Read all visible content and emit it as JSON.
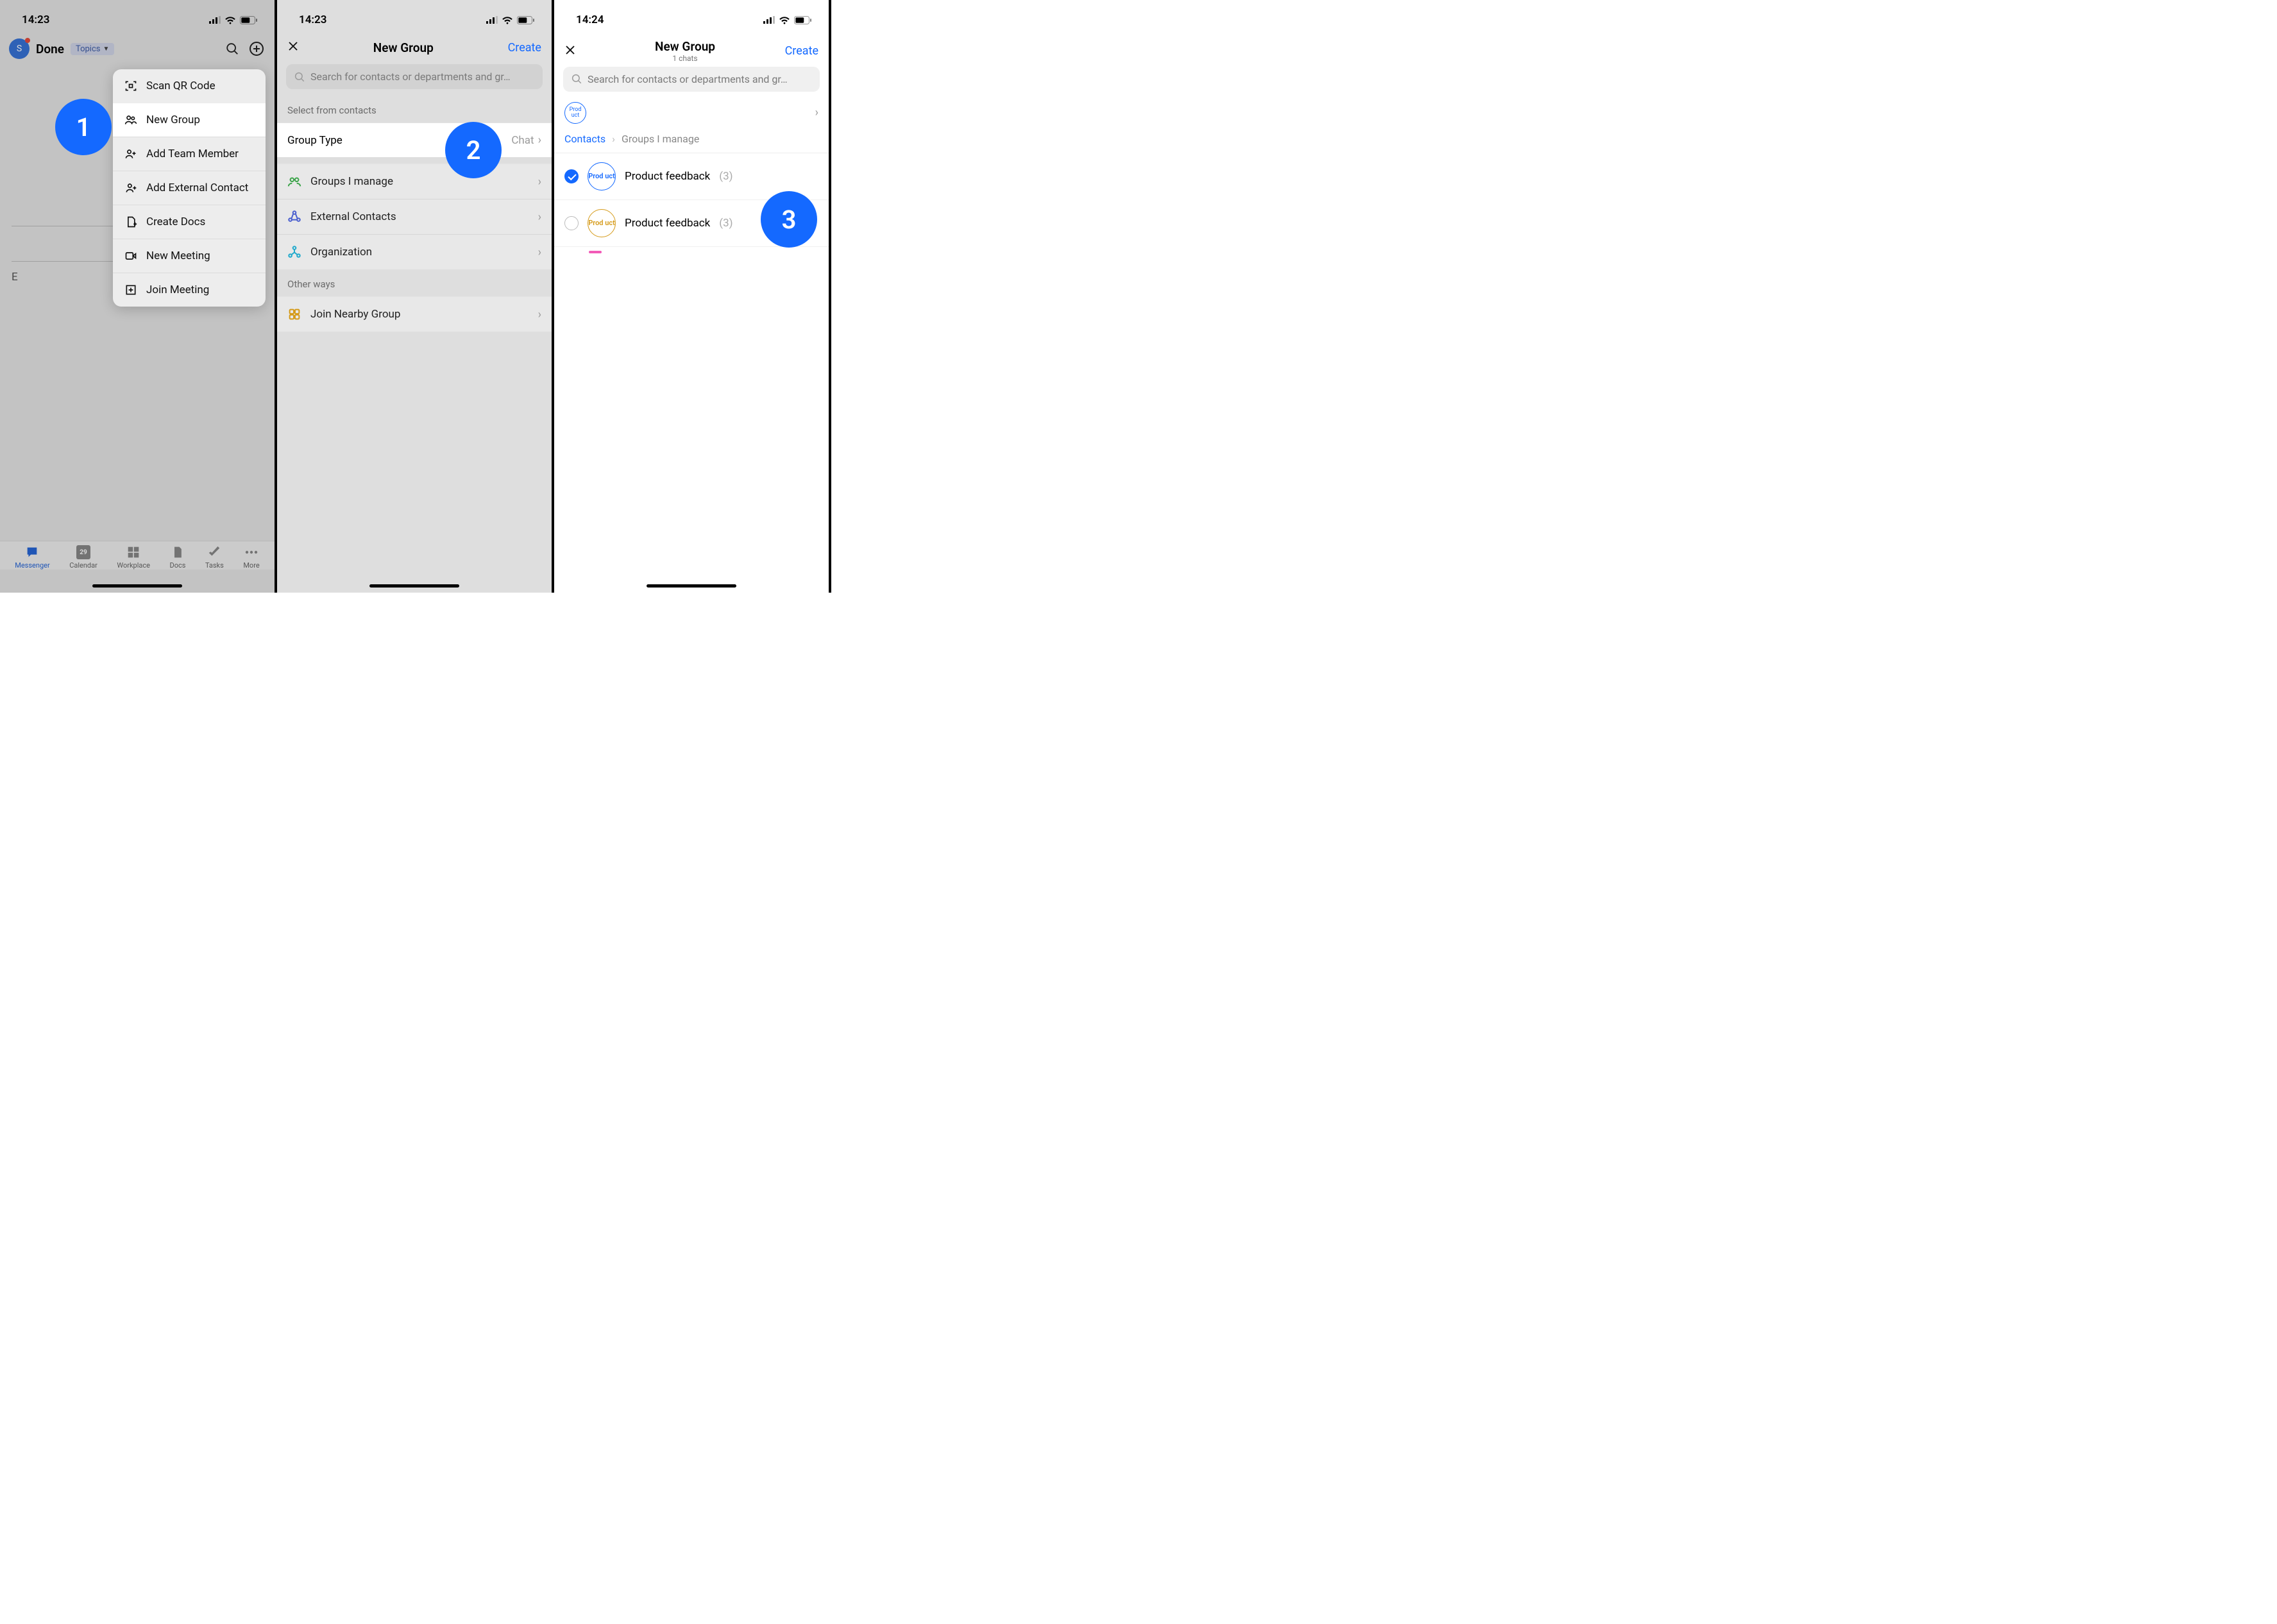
{
  "status": {
    "time1": "14:23",
    "time2": "14:23",
    "time3": "14:24"
  },
  "panel1": {
    "avatar_letter": "S",
    "done_label": "Done",
    "topics_label": "Topics",
    "body_prefix": "E",
    "popup": {
      "scan_qr": "Scan QR Code",
      "new_group": "New Group",
      "add_team_member": "Add Team Member",
      "add_external_contact": "Add External Contact",
      "create_docs": "Create Docs",
      "new_meeting": "New Meeting",
      "join_meeting": "Join Meeting"
    },
    "tabs": {
      "messenger": "Messenger",
      "calendar": "Calendar",
      "calendar_badge": "29",
      "workplace": "Workplace",
      "docs": "Docs",
      "tasks": "Tasks",
      "more": "More"
    }
  },
  "panel2": {
    "title": "New Group",
    "create": "Create",
    "search_placeholder": "Search for contacts or departments and gr…",
    "section_select": "Select from contacts",
    "group_type_label": "Group Type",
    "group_type_value": "Chat",
    "rows": {
      "groups_manage": "Groups I manage",
      "external": "External Contacts",
      "organization": "Organization"
    },
    "section_other": "Other ways",
    "join_nearby": "Join Nearby Group"
  },
  "panel3": {
    "title": "New Group",
    "subtitle": "1 chats",
    "create": "Create",
    "search_placeholder": "Search for contacts or departments and gr…",
    "chip_label": "Prod uct",
    "breadcrumb": {
      "contacts": "Contacts",
      "groups": "Groups I manage"
    },
    "items": [
      {
        "avatar": "Prod uct",
        "name": "Product feedback",
        "count": "(3)",
        "style": "blue",
        "checked": true
      },
      {
        "avatar": "Prod uct",
        "name": "Product feedback",
        "count": "(3)",
        "style": "amber",
        "checked": false
      }
    ]
  },
  "steps": {
    "s1": "1",
    "s2": "2",
    "s3": "3"
  }
}
